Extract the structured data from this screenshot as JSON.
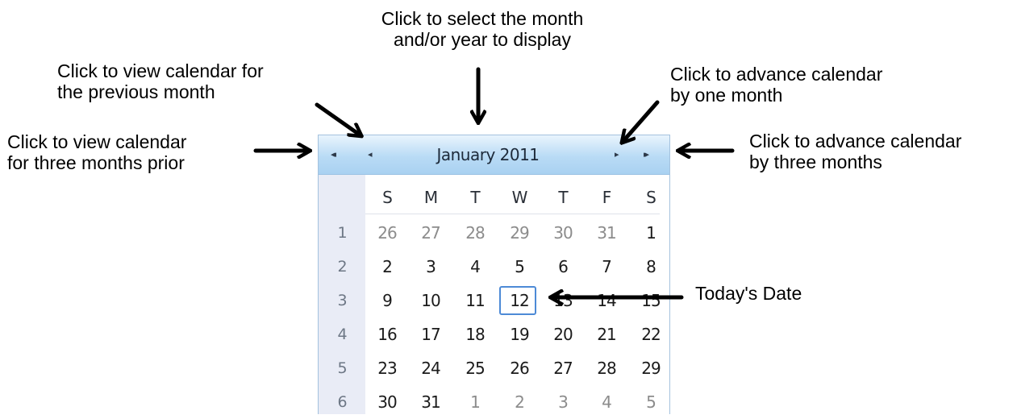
{
  "annotations": {
    "month_select": [
      "Click to select the month",
      "and/or year to display"
    ],
    "previous_month": [
      "Click to view calendar for",
      "the previous month"
    ],
    "three_months_prior": [
      "Click to view calendar",
      "for three months prior"
    ],
    "advance_one": [
      "Click to advance calendar",
      "by one month"
    ],
    "advance_three": [
      "Click to advance calendar",
      "by three months"
    ],
    "today": "Today's Date"
  },
  "calendar": {
    "title": "January 2011",
    "nav": {
      "prev_three": "◂◂",
      "prev_one": "◂",
      "next_one": "▸",
      "next_three": "▸▸"
    },
    "days_of_week": [
      "S",
      "M",
      "T",
      "W",
      "T",
      "F",
      "S"
    ],
    "weeks": [
      {
        "num": "1",
        "days": [
          "26",
          "27",
          "28",
          "29",
          "30",
          "31",
          "1"
        ]
      },
      {
        "num": "2",
        "days": [
          "2",
          "3",
          "4",
          "5",
          "6",
          "7",
          "8"
        ]
      },
      {
        "num": "3",
        "days": [
          "9",
          "10",
          "11",
          "12",
          "13",
          "14",
          "15"
        ]
      },
      {
        "num": "4",
        "days": [
          "16",
          "17",
          "18",
          "19",
          "20",
          "21",
          "22"
        ]
      },
      {
        "num": "5",
        "days": [
          "23",
          "24",
          "25",
          "26",
          "27",
          "28",
          "29"
        ]
      },
      {
        "num": "6",
        "days": [
          "30",
          "31",
          "1",
          "2",
          "3",
          "4",
          "5"
        ]
      }
    ],
    "today": "12"
  },
  "colors": {
    "header_blue": "#b9dbf5",
    "today_border": "#4d8ad6",
    "week_column": "#e9ecf6"
  }
}
